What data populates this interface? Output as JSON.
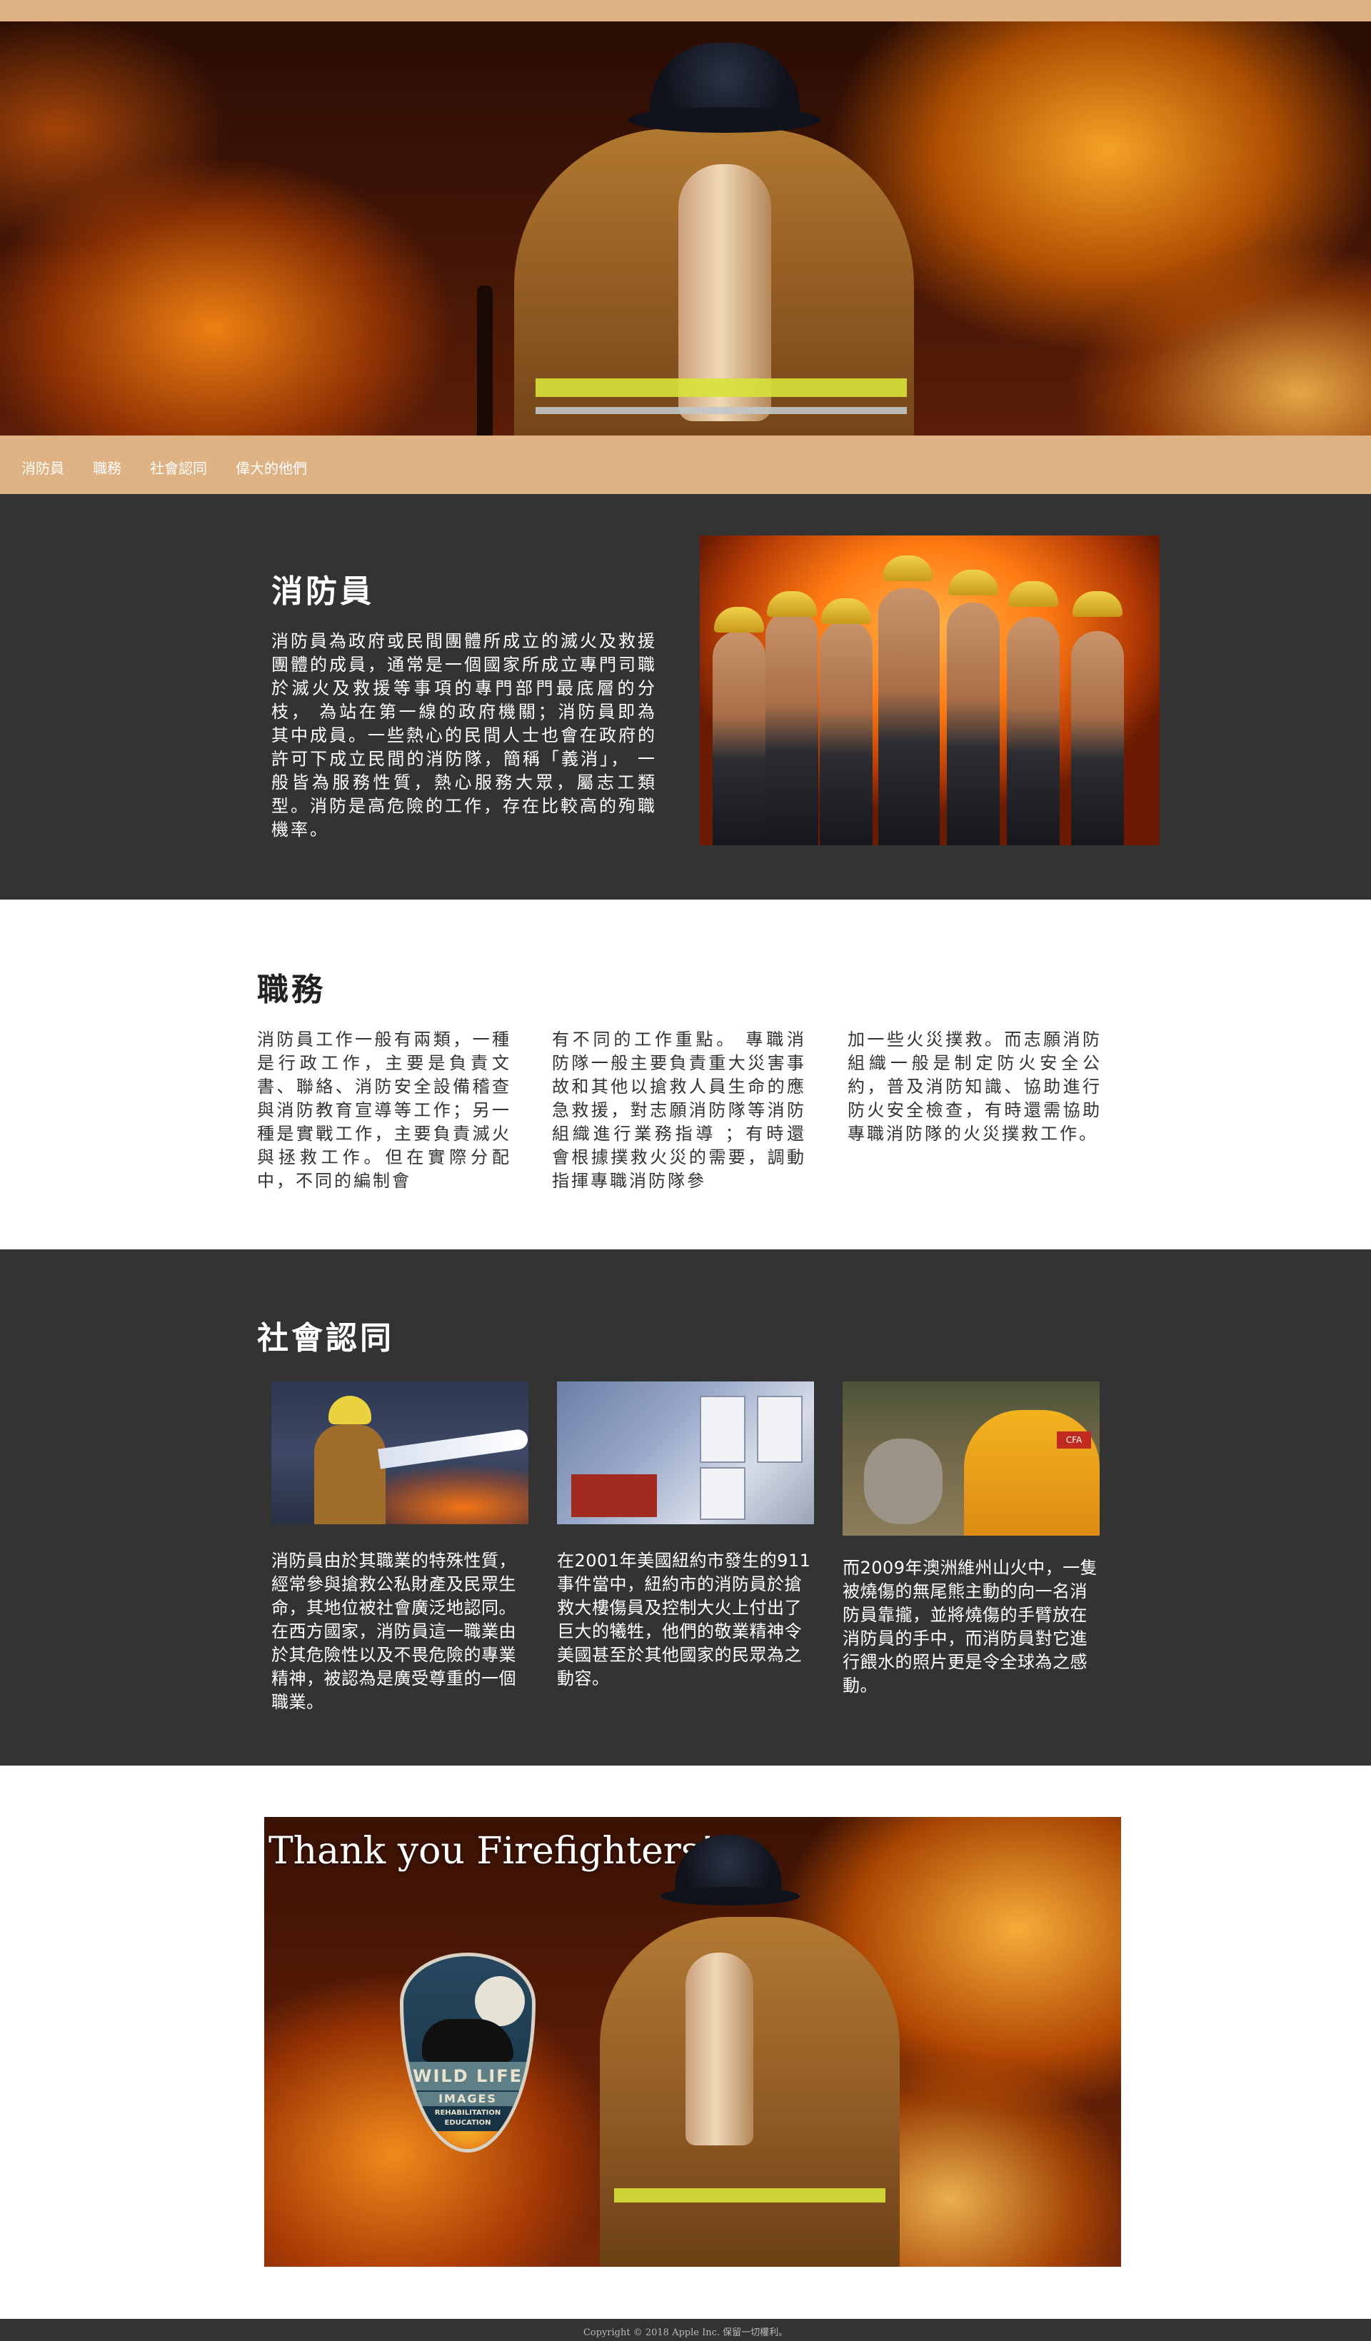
{
  "nav": {
    "items": [
      "消防員",
      "職務",
      "社會認同",
      "偉大的他們"
    ]
  },
  "section_intro": {
    "title": "消防員",
    "text": "消防員為政府或民間團體所成立的滅火及救援團體的成員，通常是一個國家所成立專門司職於滅火及救援等事項的專門部門最底層的分枝， 為站在第一線的政府機關；消防員即為其中成員。一些熱心的民間人士也會在政府的許可下成立民間的消防隊，簡稱「義消」， 一般皆為服務性質，熱心服務大眾，屬志工類型。消防是高危險的工作，存在比較高的殉職機率。"
  },
  "section_duties": {
    "title": "職務",
    "columns": [
      "消防員工作一般有兩類，一種是行政工作，主要是負責文書、聯絡、消防安全設備稽查與消防教育宣導等工作；另一種是實戰工作，主要負責滅火與拯救工作。但在實際分配中，不同的編制會",
      "有不同的工作重點。 專職消防隊一般主要負責重大災害事故和其他以搶救人員生命的應急救援，對志願消防隊等消防組織進行業務指導 ；有時還會根據撲救火災的需要，調動指揮專職消防隊參",
      "加一些火災撲救。而志願消防組織一般是制定防火安全公約，普及消防知識、協助進行防火安全檢查，有時還需協助專職消防隊的火災撲救工作。"
    ]
  },
  "section_recognition": {
    "title": "社會認同",
    "cards": [
      "消防員由於其職業的特殊性質，經常參與搶救公私財產及民眾生命，其地位被社會廣泛地認同。在西方國家，消防員這一職業由於其危險性以及不畏危險的專業精神，被認為是廣受尊重的一個職業。",
      "在2001年美國紐約市發生的911事件當中，紐約市的消防員於搶救大樓傷員及控制大火上付出了巨大的犧牲，他們的敬業精神令美國甚至於其他國家的民眾為之動容。",
      "而2009年澳洲維州山火中，一隻被燒傷的無尾熊主動的向一名消防員靠攏，並將燒傷的手臂放在消防員的手中，而消防員對它進行餵水的照片更是令全球為之感動。"
    ]
  },
  "banner": {
    "title": "Thank you Firefighters!",
    "badge": {
      "line1": "WILD LIFE",
      "line2": "IMAGES",
      "line3": "REHABILITATION",
      "line4": "EDUCATION"
    }
  },
  "footer": {
    "text": "Copyright © 2018 Apple Inc. 保留一切權利。"
  },
  "colors": {
    "accent": "#dfb283",
    "dark": "#333333"
  }
}
